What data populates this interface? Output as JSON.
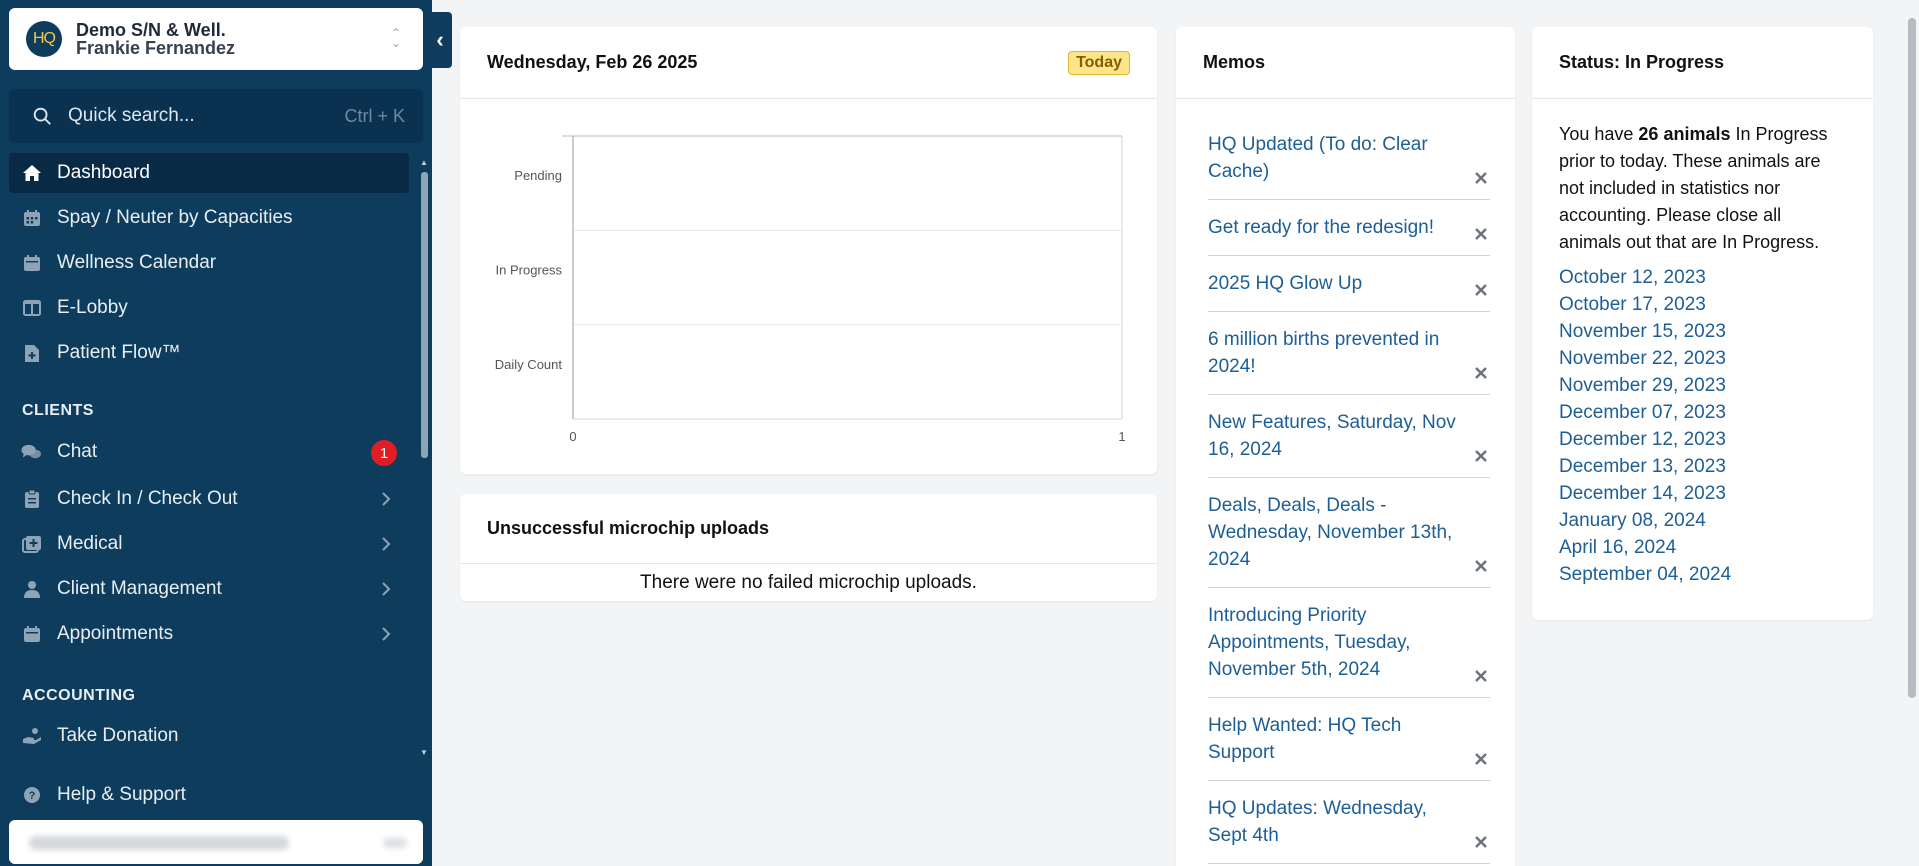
{
  "sidebar": {
    "org_logo": "HQ",
    "org_name": "Demo S/N & Well.",
    "org_user": "Frankie Fernandez",
    "search_placeholder": "Quick search...",
    "search_shortcut": "Ctrl + K",
    "items": [
      {
        "label": "Dashboard",
        "icon": "home-icon",
        "active": true
      },
      {
        "label": "Spay / Neuter by Capacities",
        "icon": "calendar-grid-icon"
      },
      {
        "label": "Wellness Calendar",
        "icon": "calendar-icon"
      },
      {
        "label": "E-Lobby",
        "icon": "columns-icon"
      },
      {
        "label": "Patient Flow™",
        "icon": "file-plus-icon"
      }
    ],
    "clients_section": "CLIENTS",
    "client_items": [
      {
        "label": "Chat",
        "icon": "chat-icon",
        "badge": "1"
      },
      {
        "label": "Check In / Check Out",
        "icon": "clipboard-icon"
      },
      {
        "label": "Medical",
        "icon": "medical-icon"
      },
      {
        "label": "Client Management",
        "icon": "user-icon"
      },
      {
        "label": "Appointments",
        "icon": "calendar-icon"
      }
    ],
    "accounting_section": "ACCOUNTING",
    "accounting_items": [
      {
        "label": "Take Donation",
        "icon": "donation-hand-icon"
      }
    ],
    "help_label": "Help & Support"
  },
  "date_card": {
    "title": "Wednesday, Feb 26 2025",
    "badge": "Today"
  },
  "chart_data": {
    "type": "bar",
    "orientation": "horizontal",
    "categories": [
      "Pending",
      "In Progress",
      "Daily Count"
    ],
    "values": [
      0,
      0,
      0
    ],
    "xlim": [
      0,
      1
    ],
    "xticks": [
      "0",
      "1"
    ],
    "grid": true
  },
  "microchip_card": {
    "title": "Unsuccessful microchip uploads",
    "message": "There were no failed microchip uploads."
  },
  "memos": {
    "title": "Memos",
    "items": [
      "HQ Updated (To do: Clear Cache)",
      "Get ready for the redesign!",
      "2025 HQ Glow Up",
      "6 million births prevented in 2024!",
      "New Features, Saturday, Nov 16, 2024",
      "Deals, Deals, Deals - Wednesday, November 13th, 2024",
      "Introducing Priority Appointments, Tuesday, November 5th, 2024",
      "Help Wanted: HQ Tech Support",
      "HQ Updates: Wednesday, Sept 4th"
    ]
  },
  "status": {
    "title": "Status: In Progress",
    "text_before": "You have ",
    "count_text": "26 animals",
    "text_after": " In Progress prior to today. These animals are not included in statistics nor accounting. Please close all animals out that are In Progress.",
    "dates": [
      "October 12, 2023",
      "October 17, 2023",
      "November 15, 2023",
      "November 22, 2023",
      "November 29, 2023",
      "December 07, 2023",
      "December 12, 2023",
      "December 13, 2023",
      "December 14, 2023",
      "January 08, 2024",
      "April 16, 2024",
      "September 04, 2024"
    ]
  },
  "colors": {
    "sidebar_bg": "#0d3c5c",
    "link": "#1d5e96",
    "badge_red": "#e11d24",
    "today_badge": "#fde68a"
  }
}
